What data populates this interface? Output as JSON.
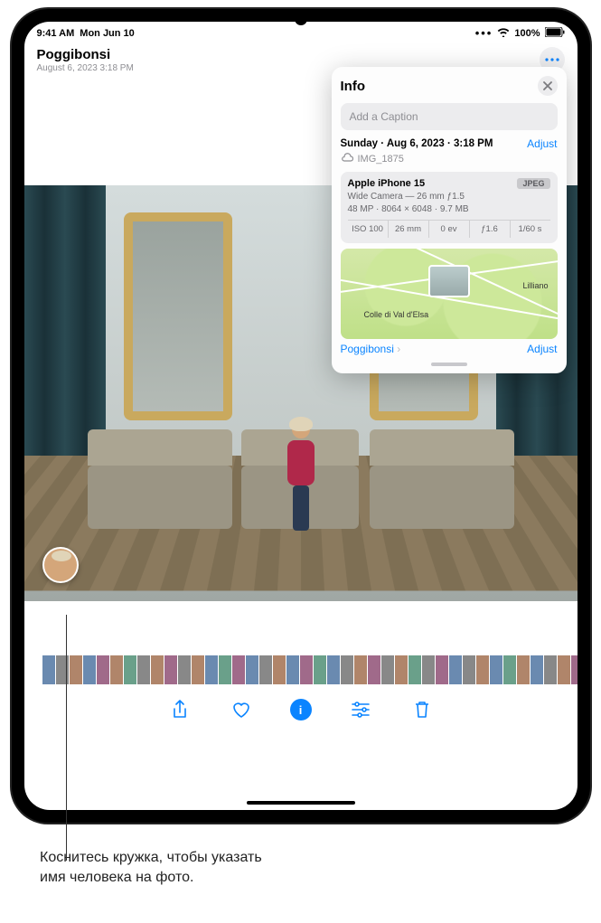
{
  "status": {
    "time": "9:41 AM",
    "date": "Mon Jun 10",
    "battery": "100%"
  },
  "header": {
    "title": "Poggibonsi",
    "subtitle": "August 6, 2023   3:18 PM"
  },
  "info": {
    "heading": "Info",
    "caption_placeholder": "Add a Caption",
    "datetime": "Sunday · Aug 6, 2023 · 3:18 PM",
    "adjust": "Adjust",
    "filename": "IMG_1875",
    "device": "Apple iPhone 15",
    "format": "JPEG",
    "lens": "Wide Camera — 26 mm ƒ1.5",
    "specs": "48 MP  ·  8064 × 6048  ·  9.7 MB",
    "exif": {
      "iso": "ISO 100",
      "focal": "26 mm",
      "ev": "0 ev",
      "aperture": "ƒ1.6",
      "shutter": "1/60 s"
    },
    "map": {
      "label1": "Colle di Val d'Elsa",
      "label2": "Lilliano",
      "location": "Poggibonsi",
      "adjust": "Adjust"
    }
  },
  "callout": {
    "line1": "Коснитесь кружка, чтобы указать",
    "line2": "имя человека на фото."
  }
}
